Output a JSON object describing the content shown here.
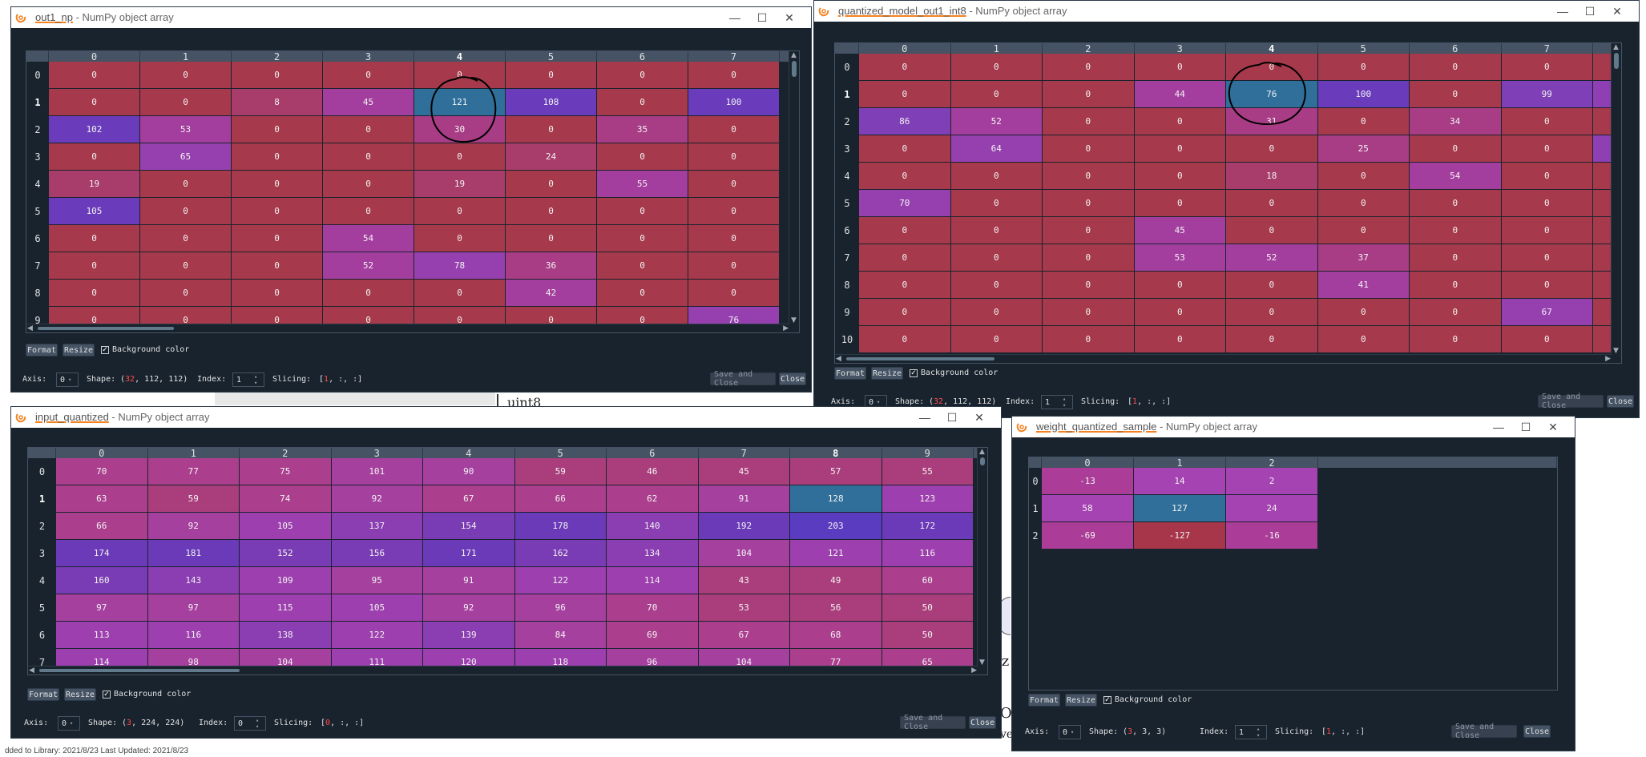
{
  "background": {
    "footer_text": "dded to Library: 2021/8/23    Last Updated: 2021/8/23",
    "fragment1": "uint8",
    "fragment2": "iz",
    "fragment3": "O",
    "fragment4": "ve"
  },
  "controls": {
    "format": "Format",
    "resize": "Resize",
    "background_color": "Background color",
    "axis_label": "Axis:",
    "shape_label": "Shape:",
    "index_label": "Index:",
    "slicing_label": "Slicing:",
    "save_close": "Save and Close",
    "close": "Close"
  },
  "windows": [
    {
      "id": "out1_np",
      "name": "out1_np",
      "suffix": " - NumPy object array",
      "axis": "0",
      "shape_pre": "(",
      "shape_red": "32",
      "shape_post": ", 112, 112)",
      "index": "1",
      "slice_pre": "[",
      "slice_red": "1",
      "slice_post": ", :, :]",
      "cols": [
        "0",
        "1",
        "2",
        "3",
        "4",
        "5",
        "6",
        "7"
      ],
      "bold_col": 4,
      "rows": [
        "0",
        "1",
        "2",
        "3",
        "4",
        "5",
        "6",
        "7",
        "8"
      ],
      "bold_row": 1,
      "values": [
        [
          "0",
          "0",
          "0",
          "0",
          "0",
          "0",
          "0",
          "0"
        ],
        [
          "0",
          "0",
          "8",
          "45",
          "121",
          "108",
          "0",
          "100"
        ],
        [
          "102",
          "53",
          "0",
          "0",
          "30",
          "0",
          "35",
          "0"
        ],
        [
          "0",
          "65",
          "0",
          "0",
          "0",
          "24",
          "0",
          "0"
        ],
        [
          "19",
          "0",
          "0",
          "0",
          "19",
          "0",
          "55",
          "0"
        ],
        [
          "105",
          "0",
          "0",
          "0",
          "0",
          "0",
          "0",
          "0"
        ],
        [
          "0",
          "0",
          "0",
          "54",
          "0",
          "0",
          "0",
          "0"
        ],
        [
          "0",
          "0",
          "0",
          "52",
          "78",
          "36",
          "0",
          "0"
        ],
        [
          "0",
          "0",
          "0",
          "0",
          "0",
          "42",
          "0",
          "0"
        ]
      ],
      "partial_row": [
        "0",
        "0",
        "0",
        "0",
        "0",
        "0",
        "0",
        "76"
      ]
    },
    {
      "id": "quantized",
      "name": "quantized_model_out1_int8",
      "suffix": " - NumPy object array",
      "axis": "0",
      "shape_pre": "(",
      "shape_red": "32",
      "shape_post": ", 112, 112)",
      "index": "1",
      "slice_pre": "[",
      "slice_red": "1",
      "slice_post": ", :, :]",
      "cols": [
        "0",
        "1",
        "2",
        "3",
        "4",
        "5",
        "6",
        "7"
      ],
      "bold_col": 4,
      "rows": [
        "0",
        "1",
        "2",
        "3",
        "4",
        "5",
        "6",
        "7",
        "8",
        "9",
        "10"
      ],
      "bold_row": 1,
      "values": [
        [
          "0",
          "0",
          "0",
          "0",
          "0",
          "0",
          "0",
          "0"
        ],
        [
          "0",
          "0",
          "0",
          "44",
          "76",
          "100",
          "0",
          "99"
        ],
        [
          "86",
          "52",
          "0",
          "0",
          "31",
          "0",
          "34",
          "0"
        ],
        [
          "0",
          "64",
          "0",
          "0",
          "0",
          "25",
          "0",
          "0"
        ],
        [
          "0",
          "0",
          "0",
          "0",
          "18",
          "0",
          "54",
          "0"
        ],
        [
          "70",
          "0",
          "0",
          "0",
          "0",
          "0",
          "0",
          "0"
        ],
        [
          "0",
          "0",
          "0",
          "45",
          "0",
          "0",
          "0",
          "0"
        ],
        [
          "0",
          "0",
          "0",
          "53",
          "52",
          "37",
          "0",
          "0"
        ],
        [
          "0",
          "0",
          "0",
          "0",
          "0",
          "41",
          "0",
          "0"
        ],
        [
          "0",
          "0",
          "0",
          "0",
          "0",
          "0",
          "0",
          "67"
        ],
        [
          "0",
          "0",
          "0",
          "0",
          "0",
          "0",
          "0",
          "0"
        ]
      ]
    },
    {
      "id": "input_quantized",
      "name": "input_quantized",
      "suffix": " - NumPy object array",
      "axis": "0",
      "shape_pre": "(",
      "shape_red": "3",
      "shape_post": ", 224, 224)",
      "index": "0",
      "slice_pre": "[",
      "slice_red": "0",
      "slice_post": ", :, :]",
      "cols": [
        "0",
        "1",
        "2",
        "3",
        "4",
        "5",
        "6",
        "7",
        "8",
        "9"
      ],
      "bold_col": 8,
      "rows": [
        "0",
        "1",
        "2",
        "3",
        "4",
        "5",
        "6",
        "7"
      ],
      "bold_row": 1,
      "values": [
        [
          "70",
          "77",
          "75",
          "101",
          "90",
          "59",
          "46",
          "45",
          "57",
          "55"
        ],
        [
          "63",
          "59",
          "74",
          "92",
          "67",
          "66",
          "62",
          "91",
          "128",
          "123"
        ],
        [
          "66",
          "92",
          "105",
          "137",
          "154",
          "178",
          "140",
          "192",
          "203",
          "172"
        ],
        [
          "174",
          "181",
          "152",
          "156",
          "171",
          "162",
          "134",
          "104",
          "121",
          "116"
        ],
        [
          "160",
          "143",
          "109",
          "95",
          "91",
          "122",
          "114",
          "43",
          "49",
          "60"
        ],
        [
          "97",
          "97",
          "115",
          "105",
          "92",
          "96",
          "70",
          "53",
          "56",
          "50"
        ],
        [
          "113",
          "116",
          "138",
          "122",
          "139",
          "84",
          "69",
          "67",
          "68",
          "50"
        ],
        [
          "114",
          "98",
          "104",
          "111",
          "120",
          "118",
          "96",
          "104",
          "77",
          "65"
        ]
      ]
    },
    {
      "id": "weight",
      "name": "weight_quantized_sample",
      "suffix": " - NumPy object array",
      "axis": "0",
      "shape_pre": "(",
      "shape_red": "3",
      "shape_post": ", 3, 3)",
      "index": "1",
      "slice_pre": "[",
      "slice_red": "1",
      "slice_post": ", :, :]",
      "cols": [
        "0",
        "1",
        "2"
      ],
      "bold_col": -1,
      "rows": [
        "0",
        "1",
        "2"
      ],
      "bold_row": -1,
      "values": [
        [
          "-13",
          "14",
          "2"
        ],
        [
          "58",
          "127",
          "24"
        ],
        [
          "-69",
          "-127",
          "-16"
        ]
      ]
    }
  ],
  "colors": {
    "accent_orange": "#f58220",
    "highlight_cell": "#2f6f9a",
    "annotation": "#000000"
  }
}
